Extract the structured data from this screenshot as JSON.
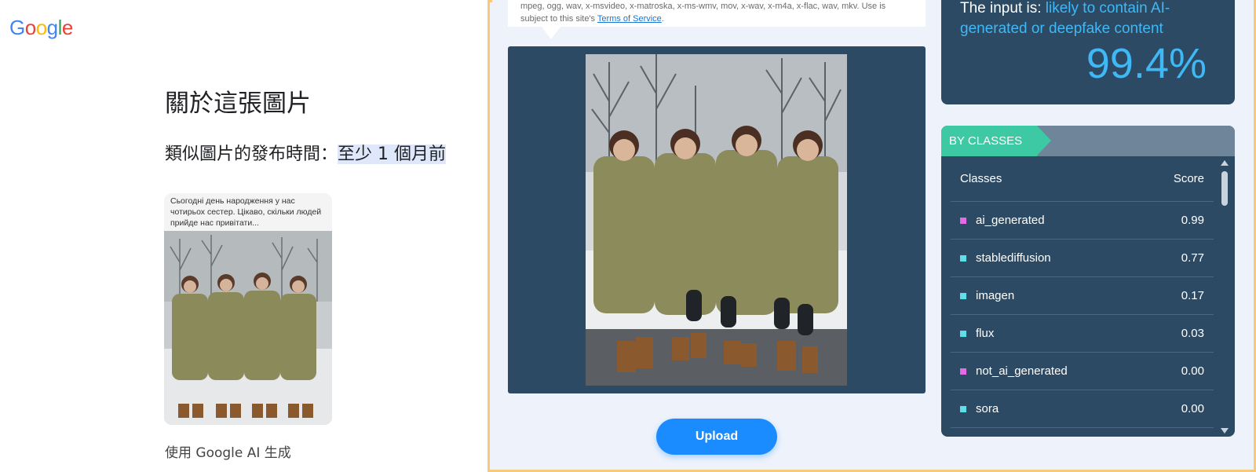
{
  "google": {
    "logo": "Google",
    "about_title": "關於這張圖片",
    "published_label": "類似圖片的發布時間：",
    "published_value": "至少 1 個月前",
    "thumbnail_caption": "Сьогодні день народження у нас чотирьох сестер. Цікаво, скільки людей прийде нас привітати...",
    "ai_note": "使用 Google AI 生成"
  },
  "detector": {
    "formats_text": "mpeg, ogg, wav, x-msvideo, x-matroska, x-ms-wmv, mov, x-wav, x-m4a, x-flac, wav, mkv. Use is subject to this site's",
    "terms_link": "Terms of Service",
    "terms_suffix": ".",
    "upload_label": "Upload",
    "result_prefix": "The input is:",
    "result_verdict": "likely to contain AI-generated or deepfake content",
    "result_percent": "99.4%",
    "by_classes_label": "BY CLASSES",
    "col_classes": "Classes",
    "col_score": "Score",
    "rows": [
      {
        "name": "ai_generated",
        "score": "0.99",
        "color": "#e36be6"
      },
      {
        "name": "stablediffusion",
        "score": "0.77",
        "color": "#5fe0e6"
      },
      {
        "name": "imagen",
        "score": "0.17",
        "color": "#5fe0e6"
      },
      {
        "name": "flux",
        "score": "0.03",
        "color": "#5fe0e6"
      },
      {
        "name": "not_ai_generated",
        "score": "0.00",
        "color": "#e36be6"
      },
      {
        "name": "sora",
        "score": "0.00",
        "color": "#5fe0e6"
      }
    ]
  },
  "colors": {
    "panel": "#2c4a63",
    "accent_blue": "#3fb8f5",
    "tag_green": "#3cc9a3",
    "upload_blue": "#1a8cff"
  }
}
